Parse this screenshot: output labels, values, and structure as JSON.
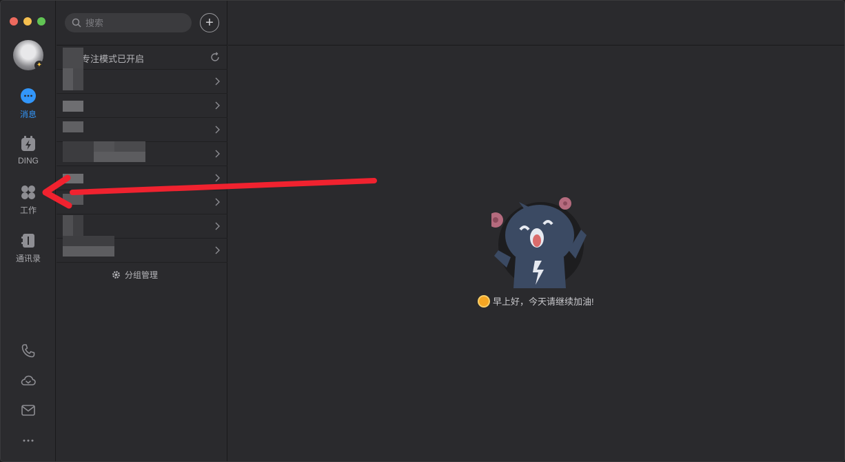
{
  "window": {
    "traffic_lights": {
      "close_color": "#ed6a5e",
      "minimize_color": "#f5bf4f",
      "zoom_color": "#61c454"
    }
  },
  "sidebar": {
    "accent_color": "#3296fa",
    "items": [
      {
        "label": "消息",
        "icon": "chat-bubble-icon",
        "active": true
      },
      {
        "label": "DING",
        "icon": "ding-lightning-icon",
        "active": false
      },
      {
        "label": "工作",
        "icon": "apps-grid-icon",
        "active": false
      },
      {
        "label": "通讯录",
        "icon": "contacts-book-icon",
        "active": false
      }
    ],
    "bottom_icons": [
      "phone-icon",
      "cloud-drive-icon",
      "mail-icon",
      "more-icon"
    ]
  },
  "list_panel": {
    "search": {
      "placeholder": "搜索"
    },
    "add_button": "+",
    "focus_mode": {
      "text": "专注模式已开启"
    },
    "groups_visible_count": 8,
    "manage_label": "分组管理"
  },
  "main": {
    "greeting": "早上好，今天请继续加油!"
  },
  "annotation": {
    "arrow_color": "#f0222f"
  }
}
